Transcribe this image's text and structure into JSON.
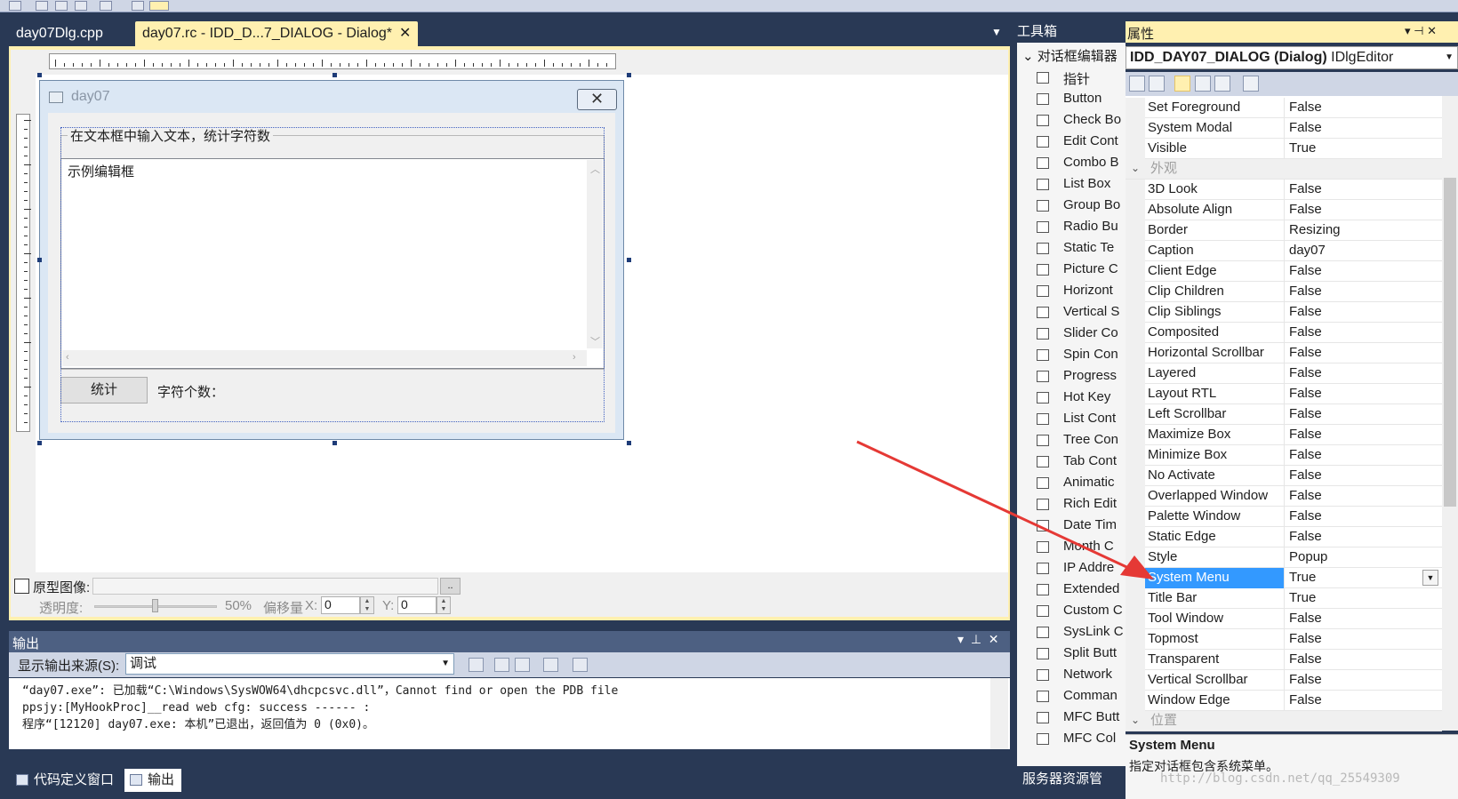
{
  "document_tabs": [
    {
      "label": "day07Dlg.cpp",
      "active": false
    },
    {
      "label": "day07.rc - IDD_D...7_DIALOG - Dialog*",
      "active": true
    }
  ],
  "designed_dialog": {
    "title": "day07",
    "group_label": "在文本框中输入文本，统计字符数",
    "edit_text": "示例编辑框",
    "count_button": "统计",
    "count_label": "字符个数："
  },
  "proto_bar": {
    "label": "原型图像:",
    "browse": "..",
    "opacity_label": "透明度:",
    "opacity_value": "50%",
    "opacity_percent": 50,
    "offset_label": "偏移量",
    "x_label": "X:",
    "x_value": "0",
    "y_label": "Y:",
    "y_value": "0"
  },
  "output": {
    "title": "输出",
    "source_label": "显示输出来源(S):",
    "source_value": "调试",
    "lines": [
      "“day07.exe”: 已加载“C:\\Windows\\SysWOW64\\dhcpcsvc.dll”，Cannot find or open the PDB file",
      "ppsjy:[MyHookProc]__read web cfg: success ------ :",
      "程序“[12120] day07.exe: 本机”已退出，返回值为 0 (0x0)。"
    ]
  },
  "bottom_tabs": [
    {
      "label": "代码定义窗口",
      "active": false
    },
    {
      "label": "输出",
      "active": true
    }
  ],
  "toolbox": {
    "title": "工具箱",
    "section": "对话框编辑器",
    "server_explorer": "服务器资源管",
    "items": [
      {
        "label": "指针",
        "icon": "pointer-icon"
      },
      {
        "label": "Button",
        "icon": "button-icon"
      },
      {
        "label": "Check Bo",
        "icon": "checkbox-icon"
      },
      {
        "label": "Edit Cont",
        "icon": "edit-control-icon"
      },
      {
        "label": "Combo B",
        "icon": "combobox-icon"
      },
      {
        "label": "List Box",
        "icon": "listbox-icon"
      },
      {
        "label": "Group Bo",
        "icon": "groupbox-icon"
      },
      {
        "label": "Radio Bu",
        "icon": "radio-icon"
      },
      {
        "label": "Static Te",
        "icon": "static-text-icon"
      },
      {
        "label": "Picture C",
        "icon": "picture-icon"
      },
      {
        "label": "Horizont",
        "icon": "hscroll-icon"
      },
      {
        "label": "Vertical S",
        "icon": "vscroll-icon"
      },
      {
        "label": "Slider Co",
        "icon": "slider-icon"
      },
      {
        "label": "Spin Con",
        "icon": "spin-icon"
      },
      {
        "label": "Progress",
        "icon": "progress-icon"
      },
      {
        "label": "Hot Key",
        "icon": "hotkey-icon"
      },
      {
        "label": "List Cont",
        "icon": "listcontrol-icon"
      },
      {
        "label": "Tree Con",
        "icon": "tree-icon"
      },
      {
        "label": "Tab Cont",
        "icon": "tab-icon"
      },
      {
        "label": "Animatic",
        "icon": "animation-icon"
      },
      {
        "label": "Rich Edit",
        "icon": "richedit-icon"
      },
      {
        "label": "Date Tim",
        "icon": "datetime-icon"
      },
      {
        "label": "Month C",
        "icon": "month-icon"
      },
      {
        "label": "IP Addre",
        "icon": "ip-icon"
      },
      {
        "label": "Extended",
        "icon": "extended-combo-icon"
      },
      {
        "label": "Custom C",
        "icon": "custom-control-icon"
      },
      {
        "label": "SysLink C",
        "icon": "syslink-icon"
      },
      {
        "label": "Split Butt",
        "icon": "split-button-icon"
      },
      {
        "label": "Network",
        "icon": "network-icon"
      },
      {
        "label": "Comman",
        "icon": "command-icon"
      },
      {
        "label": "MFC Butt",
        "icon": "mfc-button-icon"
      },
      {
        "label": "MFC Col",
        "icon": "mfc-color-icon"
      }
    ]
  },
  "properties": {
    "title": "属性",
    "object": "IDD_DAY07_DIALOG (Dialog)",
    "object_type": "IDlgEditor",
    "rows": [
      {
        "name": "Set Foreground",
        "value": "False"
      },
      {
        "name": "System Modal",
        "value": "False"
      },
      {
        "name": "Visible",
        "value": "True"
      },
      {
        "name": "外观",
        "value": "",
        "category": true
      },
      {
        "name": "3D Look",
        "value": "False"
      },
      {
        "name": "Absolute Align",
        "value": "False"
      },
      {
        "name": "Border",
        "value": "Resizing"
      },
      {
        "name": "Caption",
        "value": "day07"
      },
      {
        "name": "Client Edge",
        "value": "False"
      },
      {
        "name": "Clip Children",
        "value": "False"
      },
      {
        "name": "Clip Siblings",
        "value": "False"
      },
      {
        "name": "Composited",
        "value": "False"
      },
      {
        "name": "Horizontal Scrollbar",
        "value": "False"
      },
      {
        "name": "Layered",
        "value": "False"
      },
      {
        "name": "Layout RTL",
        "value": "False"
      },
      {
        "name": "Left Scrollbar",
        "value": "False"
      },
      {
        "name": "Maximize Box",
        "value": "False"
      },
      {
        "name": "Minimize Box",
        "value": "False"
      },
      {
        "name": "No Activate",
        "value": "False"
      },
      {
        "name": "Overlapped Window",
        "value": "False"
      },
      {
        "name": "Palette Window",
        "value": "False"
      },
      {
        "name": "Static Edge",
        "value": "False"
      },
      {
        "name": "Style",
        "value": "Popup"
      },
      {
        "name": "System Menu",
        "value": "True",
        "selected": true
      },
      {
        "name": "Title Bar",
        "value": "True"
      },
      {
        "name": "Tool Window",
        "value": "False"
      },
      {
        "name": "Topmost",
        "value": "False"
      },
      {
        "name": "Transparent",
        "value": "False"
      },
      {
        "name": "Vertical Scrollbar",
        "value": "False"
      },
      {
        "name": "Window Edge",
        "value": "False"
      },
      {
        "name": "位置",
        "value": "",
        "category": true
      }
    ],
    "desc_title": "System Menu",
    "desc_text": "指定对话框包含系统菜单。"
  },
  "watermark": "http://blog.csdn.net/qq_25549309",
  "colors": {
    "frame": "#293955",
    "active_tab": "#fff0b0",
    "selection": "#3399ff",
    "annotation_arrow": "#e53935"
  }
}
